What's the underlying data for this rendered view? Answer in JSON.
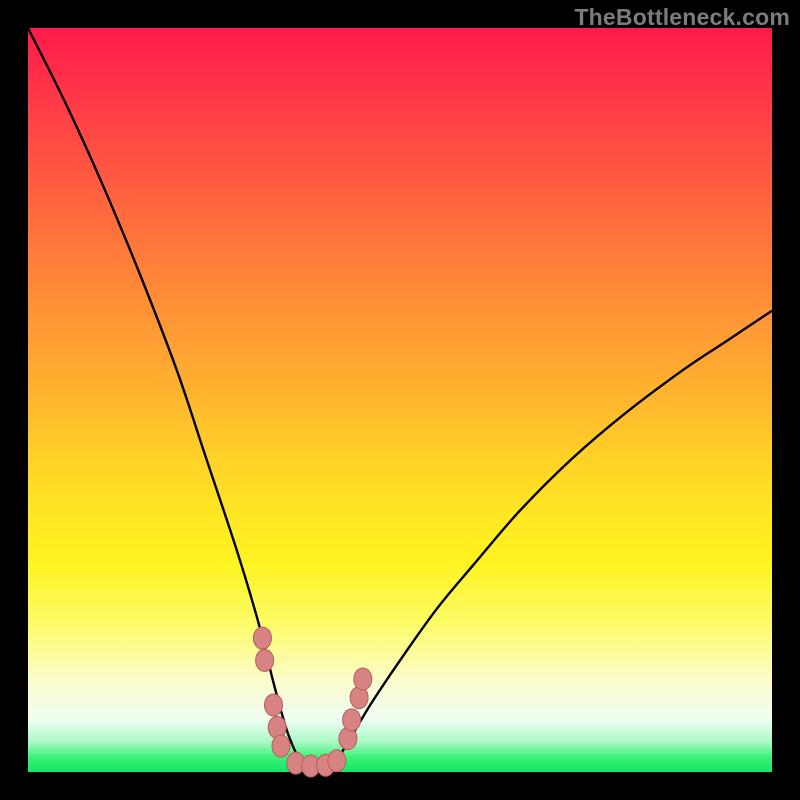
{
  "watermark": "TheBottleneck.com",
  "colors": {
    "frame": "#000000",
    "curve": "#000000",
    "marker_fill": "#d88383",
    "marker_stroke": "#b95b5b"
  },
  "chart_data": {
    "type": "line",
    "title": "",
    "xlabel": "",
    "ylabel": "",
    "xlim": [
      0,
      100
    ],
    "ylim": [
      0,
      100
    ],
    "grid": false,
    "legend": false,
    "note": "V-shaped bottleneck curve. Approx. y ≈ |x − 37| with steeper left flank. x=0→y≈100, minimum plateau y≈0 over x∈[34,42], x=100→y≈62. Salmon markers cluster along the valley walls near the minimum.",
    "series": [
      {
        "name": "bottleneck-curve",
        "x": [
          0,
          5,
          10,
          15,
          20,
          24,
          28,
          31,
          33,
          35,
          37,
          39,
          41,
          43,
          46,
          50,
          55,
          60,
          66,
          73,
          80,
          88,
          94,
          100
        ],
        "y": [
          100,
          90,
          79,
          67,
          54,
          42,
          30,
          20,
          12,
          5,
          1,
          0.5,
          1,
          4,
          9,
          15,
          22,
          28,
          35,
          42,
          48,
          54,
          58,
          62
        ]
      }
    ],
    "markers": [
      {
        "x": 31.5,
        "y": 18
      },
      {
        "x": 31.8,
        "y": 15
      },
      {
        "x": 33.0,
        "y": 9
      },
      {
        "x": 33.5,
        "y": 6
      },
      {
        "x": 34.0,
        "y": 3.5
      },
      {
        "x": 36.0,
        "y": 1.2
      },
      {
        "x": 38.0,
        "y": 0.8
      },
      {
        "x": 40.0,
        "y": 0.9
      },
      {
        "x": 41.5,
        "y": 1.5
      },
      {
        "x": 43.0,
        "y": 4.5
      },
      {
        "x": 43.5,
        "y": 7
      },
      {
        "x": 44.5,
        "y": 10
      },
      {
        "x": 45.0,
        "y": 12.5
      }
    ]
  }
}
